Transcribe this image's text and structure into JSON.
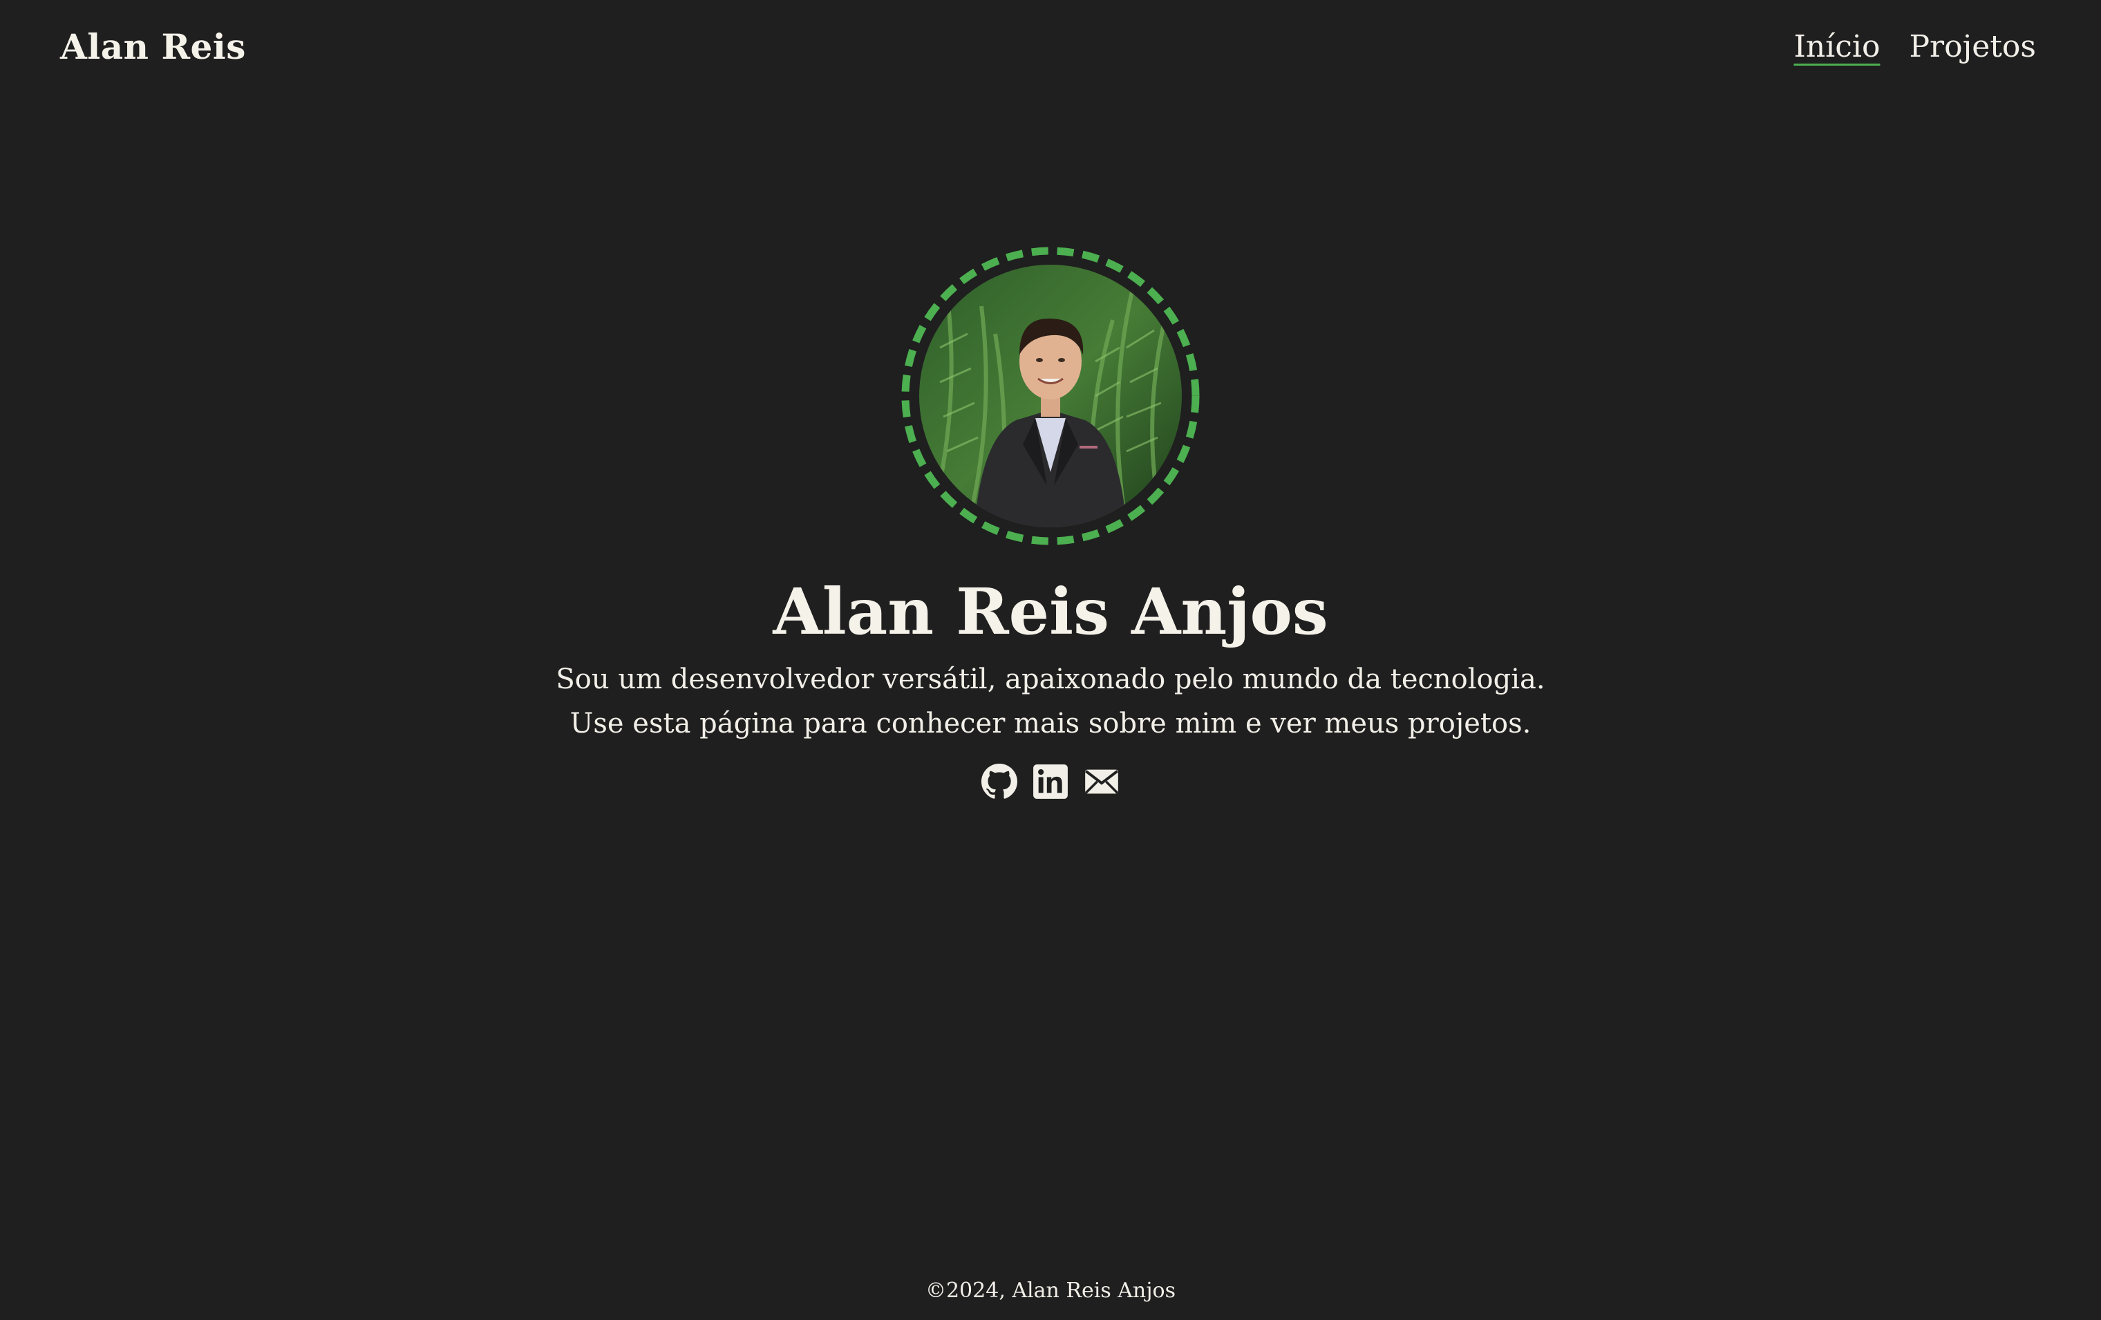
{
  "header": {
    "brand": "Alan Reis",
    "nav": [
      {
        "label": "Início",
        "active": true
      },
      {
        "label": "Projetos",
        "active": false
      }
    ]
  },
  "hero": {
    "name": "Alan Reis Anjos",
    "bio_line1": "Sou um desenvolvedor versátil, apaixonado pelo mundo da tecnologia.",
    "bio_line2": "Use esta página para conhecer mais sobre mim e ver meus projetos.",
    "avatar_ring_color": "#4caf50",
    "socials": [
      {
        "icon": "github-icon"
      },
      {
        "icon": "linkedin-icon"
      },
      {
        "icon": "mail-icon"
      }
    ]
  },
  "footer": {
    "text": "©2024, Alan Reis Anjos"
  },
  "colors": {
    "background": "#1f1f1f",
    "text": "#f2efe8",
    "accent": "#4caf50"
  }
}
